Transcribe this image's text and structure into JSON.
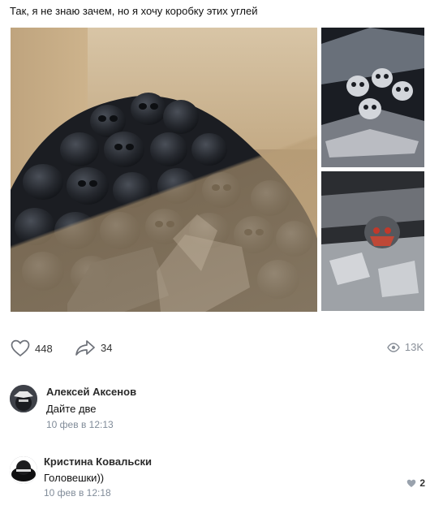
{
  "post": {
    "text": "Так, я не знаю зачем, но я хочу коробку этих углей"
  },
  "actions": {
    "likes": "448",
    "shares": "34",
    "views": "13K"
  },
  "comments": [
    {
      "author": "Алексей Аксенов",
      "text": "Дайте две",
      "date": "10 фев в 12:13"
    },
    {
      "author": "Кристина Ковальски",
      "text": "Головешки))",
      "date": "10 фев в 12:18",
      "likes": "2"
    }
  ],
  "colors": {
    "meta_text": "#818c99",
    "icon": "#6d7179"
  },
  "icons": [
    "heart-icon",
    "share-arrow-icon",
    "eye-icon",
    "comment-heart-icon"
  ]
}
